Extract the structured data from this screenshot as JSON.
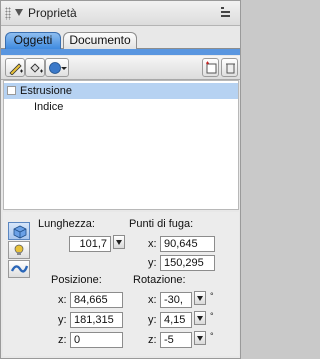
{
  "panel": {
    "title": "Proprietà"
  },
  "tabs": [
    {
      "label": "Oggetti"
    },
    {
      "label": "Documento"
    }
  ],
  "list": {
    "items": [
      {
        "label": "Estrusione"
      },
      {
        "label": "Indice"
      }
    ]
  },
  "props": {
    "length_label": "Lunghezza:",
    "length_value": "101,7",
    "vanishing_label": "Punti di fuga:",
    "vanishing_x_label": "x:",
    "vanishing_x_value": "90,645",
    "vanishing_y_label": "y:",
    "vanishing_y_value": "150,295",
    "position_label": "Posizione:",
    "pos_x_label": "x:",
    "pos_x_value": "84,665",
    "pos_y_label": "y:",
    "pos_y_value": "181,315",
    "pos_z_label": "z:",
    "pos_z_value": "0",
    "rotation_label": "Rotazione:",
    "rot_x_label": "x:",
    "rot_x_value": "-30,",
    "rot_y_label": "y:",
    "rot_y_value": "4,15",
    "rot_z_label": "z:",
    "rot_z_value": "-5",
    "degree_symbol": "°"
  }
}
